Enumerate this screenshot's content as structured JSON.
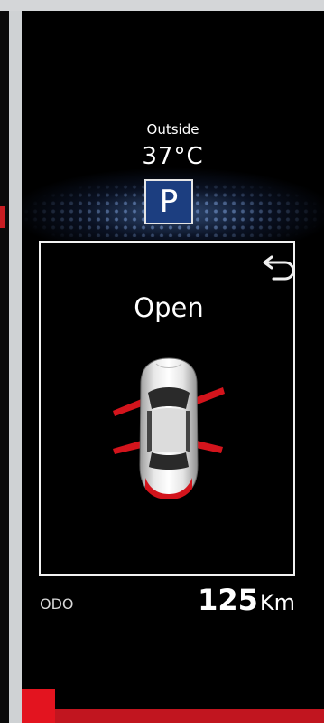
{
  "outside": {
    "label": "Outside",
    "temperature": "37°C"
  },
  "gear": {
    "position": "P"
  },
  "door_status": {
    "title": "Open",
    "doors_open": [
      "front-left",
      "front-right",
      "rear-left",
      "rear-right"
    ]
  },
  "odometer": {
    "label": "ODO",
    "value": "125",
    "unit": "Km"
  },
  "icons": {
    "back": "return-arrow-icon",
    "car": "car-top-view-icon"
  },
  "colors": {
    "background": "#000000",
    "panel_border": "#f2f2f2",
    "gear_box": "#1c3e80",
    "open_door": "#d3141c",
    "accent_red": "#e3141f"
  }
}
